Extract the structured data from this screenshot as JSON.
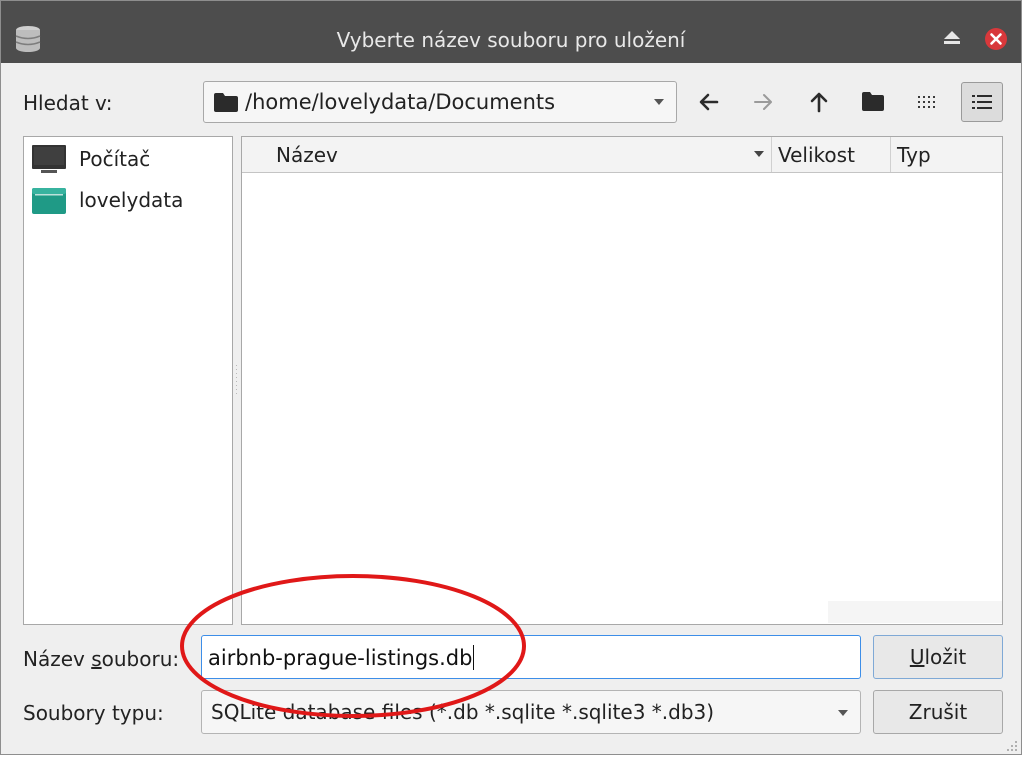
{
  "window": {
    "title": "Vyberte název souboru pro uložení",
    "icons": {
      "app": "database-icon",
      "eject": "eject-icon",
      "close": "close-icon"
    }
  },
  "lookin": {
    "label": "Hledat v:",
    "path": "/home/lovelydata/Documents"
  },
  "toolbar": {
    "buttons": [
      "back-arrow-icon",
      "forward-arrow-icon",
      "up-arrow-icon",
      "new-folder-icon",
      "icon-view-icon",
      "detail-view-icon"
    ],
    "active_view": "detail-view"
  },
  "sidebar": {
    "items": [
      {
        "label": "Počítač",
        "icon": "computer-icon"
      },
      {
        "label": "lovelydata",
        "icon": "home-folder-icon"
      }
    ]
  },
  "filelist": {
    "columns": [
      {
        "label": "Název"
      },
      {
        "label": "Velikost"
      },
      {
        "label": "Typ"
      }
    ],
    "rows": []
  },
  "filename": {
    "label_before": "Název ",
    "label_mnemonic": "s",
    "label_after": "ouboru:",
    "value": "airbnb-prague-listings.db"
  },
  "save": {
    "mnemonic": "U",
    "label_rest": "ložit"
  },
  "filetype": {
    "label": "Soubory typu:",
    "value": "SQLite database files (*.db *.sqlite *.sqlite3 *.db3)"
  },
  "cancel": {
    "label": "Zrušit"
  },
  "colors": {
    "titlebar": "#4d4d4d",
    "close": "#d8383b",
    "focus": "#3d8ee8",
    "folder_teal": "#1f9a86",
    "annotation_red": "#e01818"
  }
}
